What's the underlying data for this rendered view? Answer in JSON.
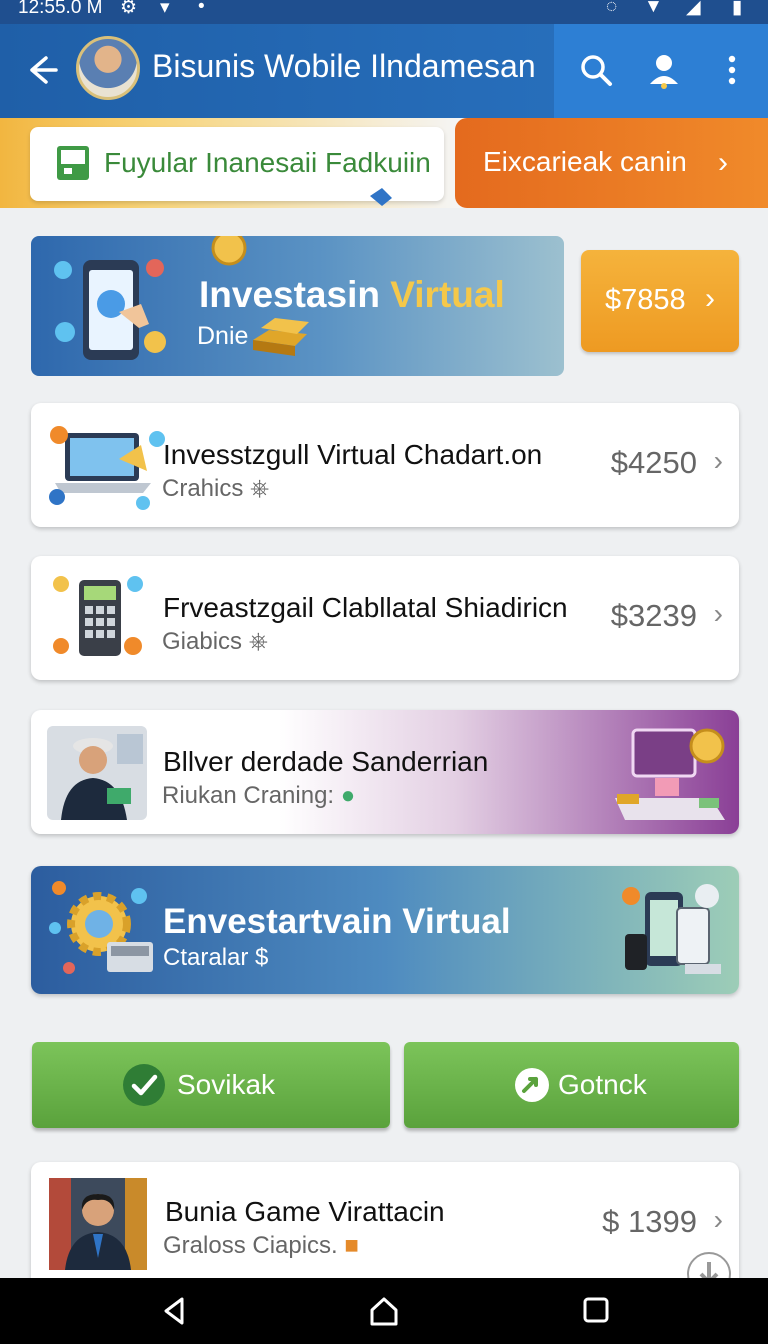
{
  "status_bar": {
    "time": "12:55.0 M"
  },
  "app_bar": {
    "title": "Bisunis Wobile Ilndamesan"
  },
  "promo": {
    "input_text": "Fuyular Inanesaii Fadkuiin",
    "button_label": "Eixcarieak canin"
  },
  "hero": {
    "title_main": "Investasin ",
    "title_highlight": "Virtual",
    "subtitle": "Dnie",
    "price_button": "$7858"
  },
  "items": [
    {
      "title": "Invesstzgull Virtual Chadart.on",
      "subtitle": "Crahics",
      "price": "$4250"
    },
    {
      "title": "Frveastzgail Clabllatal Shiadiricn",
      "subtitle": "Giabics",
      "price": "$3239"
    },
    {
      "title": "Bllver derdade Sanderrian",
      "subtitle": "Riukan Craning:"
    },
    {
      "title": "Envestartvain Virtual",
      "subtitle": "Ctaralar $"
    },
    {
      "title": "Bunia Game Virattacin",
      "subtitle": "Graloss Ciapics.",
      "price": "$ 1399"
    }
  ],
  "actions": {
    "left_label": "Sovikak",
    "right_label": "Gotnck"
  },
  "colors": {
    "app_bar": "#1f5fa8",
    "orange": "#e46a1e",
    "green": "#6bb34a",
    "hero": "#2e68ad"
  },
  "icons": [
    "back-arrow-icon",
    "search-icon",
    "profile-icon",
    "more-vert-icon",
    "wallet-icon",
    "chevron-right-icon",
    "check-icon",
    "refresh-icon",
    "nav-back-icon",
    "nav-home-icon",
    "nav-recents-icon"
  ]
}
